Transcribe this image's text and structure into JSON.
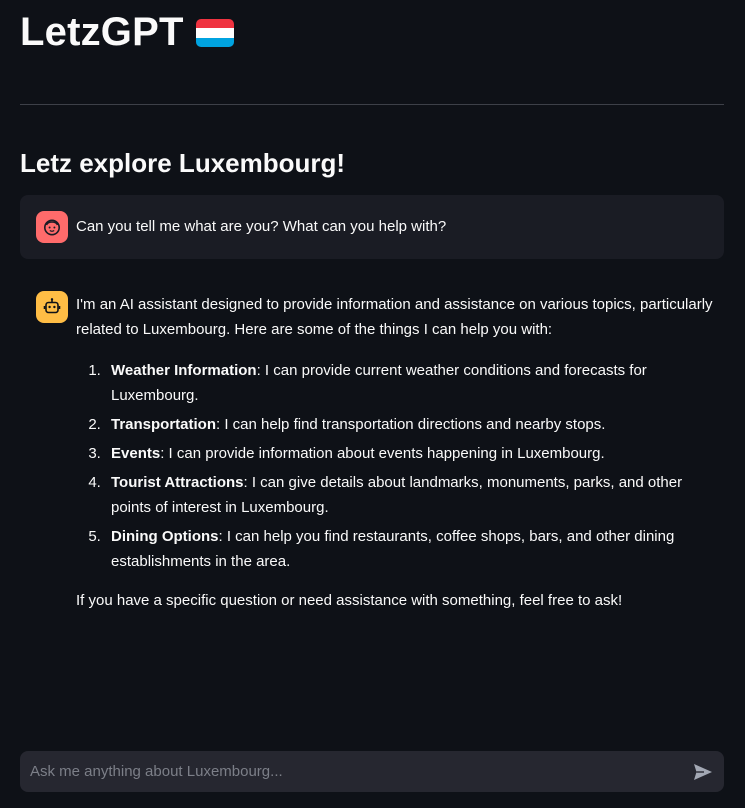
{
  "header": {
    "title": "LetzGPT",
    "flag_icon": "luxembourg-flag-icon",
    "flag_colors": [
      "#ef3340",
      "#ffffff",
      "#00a3e0"
    ]
  },
  "subheader": "Letz explore Luxembourg!",
  "messages": {
    "user": {
      "avatar_icon": "user-face-icon",
      "avatar_color": "#ff6b6b",
      "text": "Can you tell me what are you? What can you help with?"
    },
    "assistant": {
      "avatar_icon": "robot-icon",
      "avatar_color": "#ffbd45",
      "intro": "I'm an AI assistant designed to provide information and assistance on various topics, particularly related to Luxembourg. Here are some of the things I can help you with:",
      "items": [
        {
          "title": "Weather Information",
          "text": ": I can provide current weather conditions and forecasts for Luxembourg."
        },
        {
          "title": "Transportation",
          "text": ": I can help find transportation directions and nearby stops."
        },
        {
          "title": "Events",
          "text": ": I can provide information about events happening in Luxembourg."
        },
        {
          "title": "Tourist Attractions",
          "text": ": I can give details about landmarks, monuments, parks, and other points of interest in Luxembourg."
        },
        {
          "title": "Dining Options",
          "text": ": I can help you find restaurants, coffee shops, bars, and other dining establishments in the area."
        }
      ],
      "outro": "If you have a specific question or need assistance with something, feel free to ask!"
    }
  },
  "chat_input": {
    "placeholder": "Ask me anything about Luxembourg...",
    "value": "",
    "send_icon": "send-icon"
  }
}
